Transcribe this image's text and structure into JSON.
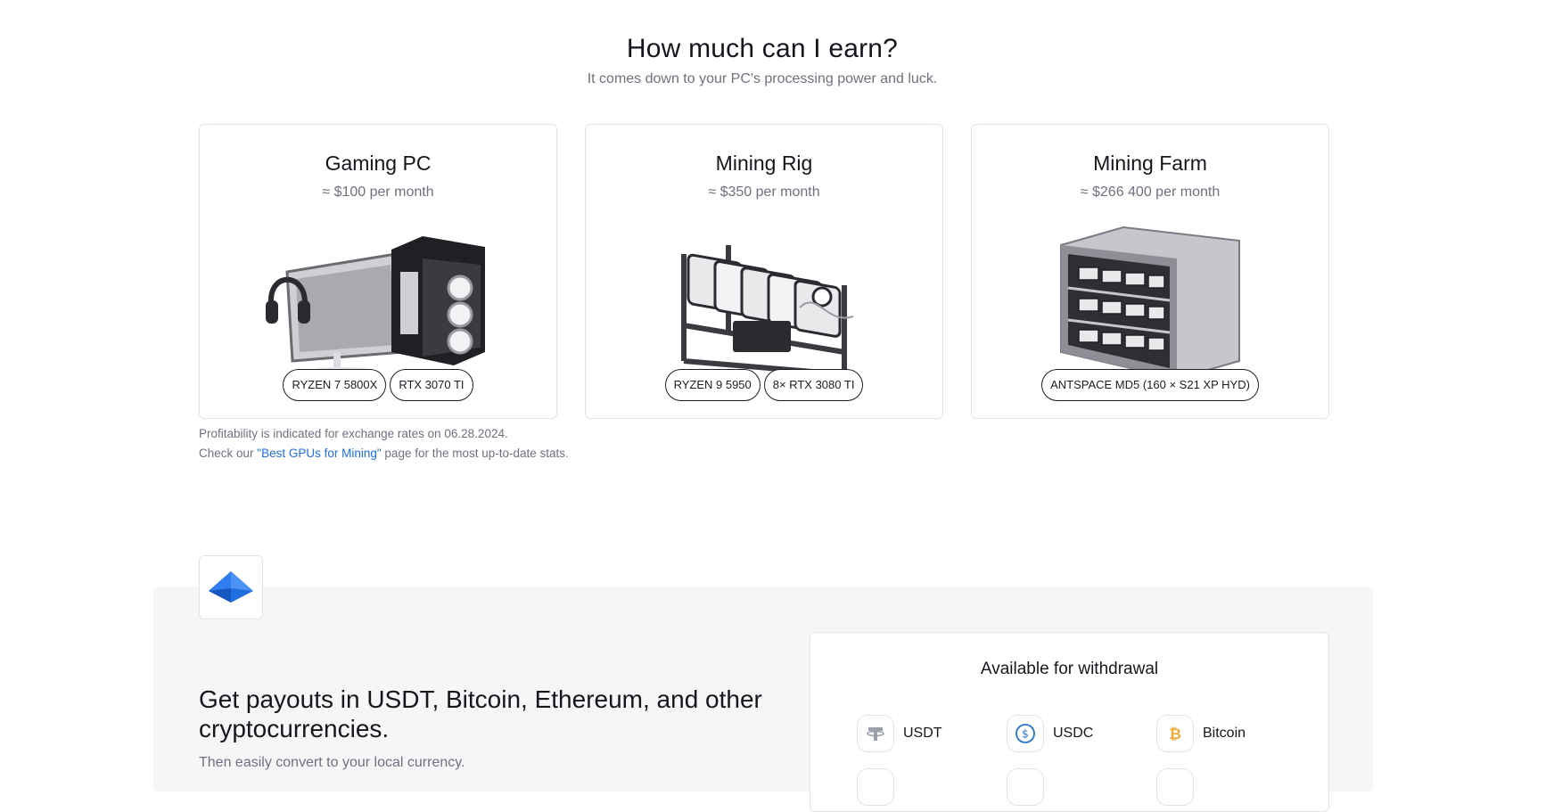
{
  "header": {
    "title": "How much can I earn?",
    "subtitle": "It comes down to your PC's processing power and luck."
  },
  "cards": [
    {
      "title": "Gaming PC",
      "price": "≈ $100 per month",
      "image": "gaming-pc-illustration",
      "chips": [
        "RYZEN 7 5800X",
        "RTX 3070 TI"
      ]
    },
    {
      "title": "Mining Rig",
      "price": "≈ $350 per month",
      "image": "mining-rig-illustration",
      "chips": [
        "RYZEN 9 5950",
        "8× RTX 3080 TI"
      ]
    },
    {
      "title": "Mining Farm",
      "price": "≈ $266 400 per month",
      "image": "mining-farm-illustration",
      "chips": [
        "ANTSPACE MD5 (160 × S21 XP HYD)"
      ]
    }
  ],
  "note": {
    "line1": "Profitability is indicated for exchange rates on 06.28.2024.",
    "line2_before": "Check our ",
    "line2_link": "\"Best GPUs for Mining\"",
    "line2_after": " page for the most up-to-date stats."
  },
  "payouts": {
    "logo_icon": "blue-gem-logo",
    "title": "Get payouts in USDT, Bitcoin, Ethereum, and other cryptocurrencies.",
    "subtitle": "Then easily convert to your local currency."
  },
  "withdrawal": {
    "title": "Available for withdrawal",
    "coins": [
      {
        "label": "USDT",
        "icon": "tether-icon",
        "color": "#9aa0aa"
      },
      {
        "label": "USDC",
        "icon": "usdc-icon",
        "color": "#2775ca"
      },
      {
        "label": "Bitcoin",
        "icon": "bitcoin-icon",
        "color": "#f2a93b"
      }
    ]
  },
  "colors": {
    "link": "#1f6fe0",
    "accent_blue": "#1f6fe0"
  }
}
